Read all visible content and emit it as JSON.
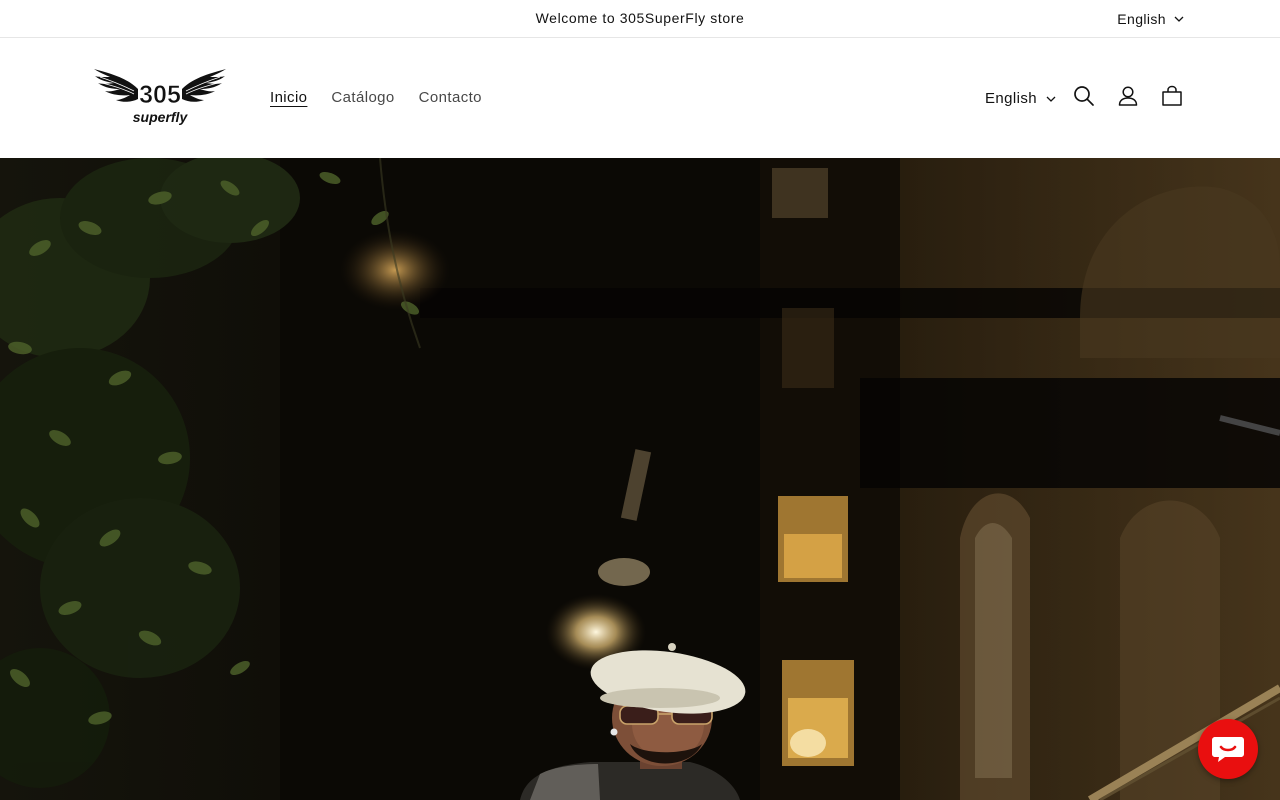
{
  "announcement": {
    "text": "Welcome to 305SuperFly store",
    "language": "English"
  },
  "header": {
    "logo": {
      "number": "305",
      "word": "superfly"
    },
    "nav": [
      {
        "label": "Inicio",
        "active": true
      },
      {
        "label": "Catálogo",
        "active": false
      },
      {
        "label": "Contacto",
        "active": false
      }
    ],
    "language": "English",
    "icons": [
      "search-icon",
      "account-icon",
      "cart-icon"
    ]
  },
  "hero": {
    "image": "night street scene: man in white beret and tinted glasses under street lights"
  },
  "chat": {
    "icon": "chat-bubble-icon",
    "color": "#e90f0f"
  }
}
